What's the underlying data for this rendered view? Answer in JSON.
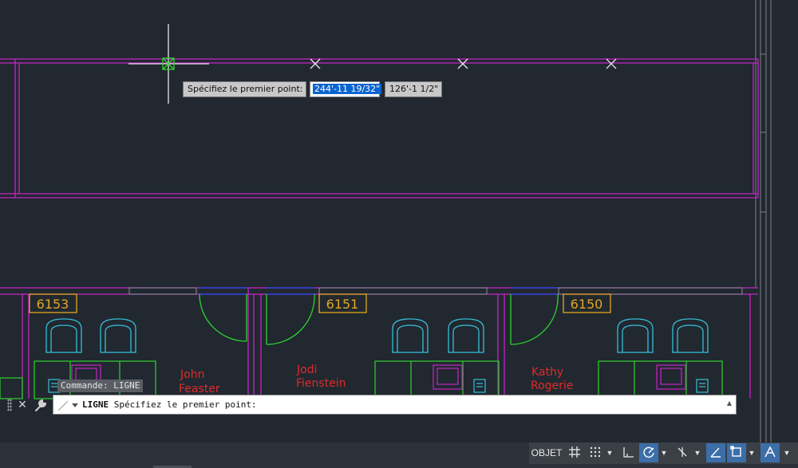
{
  "tooltip": {
    "prompt": "Spécifiez le premier point:",
    "x_value": "244'-11 19/32\"",
    "y_value": "126'-1 1/2\""
  },
  "rooms": [
    {
      "number": "6153",
      "occupant_line1": "John",
      "occupant_line2": "Feaster"
    },
    {
      "number": "6151",
      "occupant_line1": "Jodi",
      "occupant_line2": "Fienstein"
    },
    {
      "number": "6150",
      "occupant_line1": "Kathy",
      "occupant_line2": "Rogerie"
    }
  ],
  "command_line": {
    "history": "Commande: LIGNE",
    "command": "LIGNE",
    "prompt": "Spécifiez le premier point:",
    "close_icon": "close-icon",
    "customize_icon": "wrench-icon"
  },
  "status_bar": {
    "model_label": "OBJET",
    "icons": [
      "grid-icon",
      "snap-icon",
      "ortho-icon",
      "polar-icon",
      "osnap-tracking-icon",
      "isodraft-icon",
      "selection-cycling-icon",
      "annotation-icon"
    ]
  },
  "colors": {
    "background": "#212830",
    "wall": "#c724c7",
    "door": "#2fd12f",
    "room_tag": "#e1a820",
    "furniture": "#36c0d8",
    "names": "#e02b2b",
    "status_active": "#3c6ea8"
  }
}
